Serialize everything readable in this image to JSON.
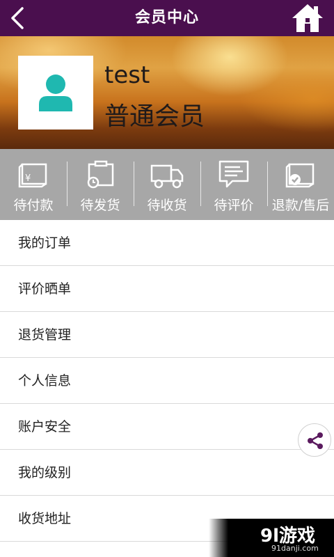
{
  "header": {
    "title": "会员中心",
    "background": "#4a0f4e"
  },
  "profile": {
    "username": "test",
    "level": "普通会员",
    "avatar_color": "#1fb8b0"
  },
  "order_status": [
    {
      "label": "待付款",
      "icon": "wallet-yen-icon"
    },
    {
      "label": "待发货",
      "icon": "box-clock-icon"
    },
    {
      "label": "待收货",
      "icon": "truck-icon"
    },
    {
      "label": "待评价",
      "icon": "chat-lines-icon"
    },
    {
      "label": "退款/售后",
      "icon": "return-check-icon"
    }
  ],
  "menu": [
    {
      "label": "我的订单"
    },
    {
      "label": "评价晒单"
    },
    {
      "label": "退货管理"
    },
    {
      "label": "个人信息"
    },
    {
      "label": "账户安全"
    },
    {
      "label": "我的级别"
    },
    {
      "label": "收货地址"
    }
  ],
  "watermark": {
    "main": "9l游戏",
    "sub": "91danji.com"
  }
}
